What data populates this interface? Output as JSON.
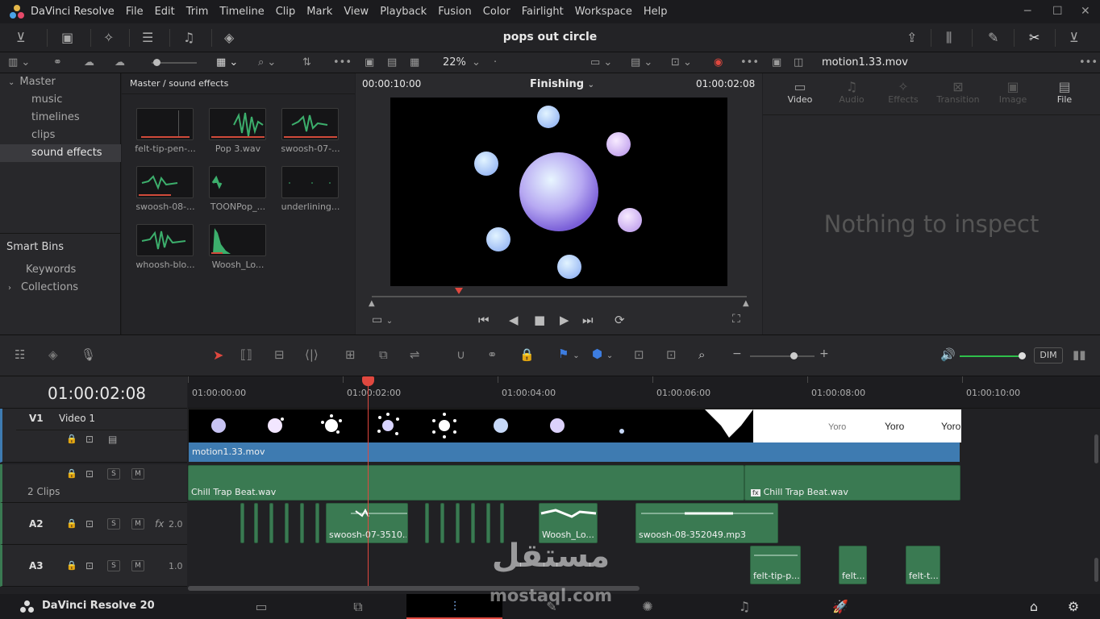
{
  "menu": {
    "app_name": "DaVinci Resolve",
    "items": [
      "File",
      "Edit",
      "Trim",
      "Timeline",
      "Clip",
      "Mark",
      "View",
      "Playback",
      "Fusion",
      "Color",
      "Fairlight",
      "Workspace",
      "Help"
    ]
  },
  "project_title": "pops out circle",
  "media_pool": {
    "zoom_label": "22%",
    "breadcrumb": "Master / sound effects",
    "bins": {
      "master": "Master",
      "children": [
        "music",
        "timelines",
        "clips",
        "sound effects"
      ],
      "selected": "sound effects"
    },
    "smart_bins": {
      "title": "Smart Bins",
      "items": [
        "Keywords",
        "Collections"
      ]
    },
    "clips": [
      "felt-tip-pen-...",
      "Pop 3.wav",
      "swoosh-07-...",
      "swoosh-08-...",
      "TOONPop_...",
      "underlining...",
      "whoosh-blo...",
      "Woosh_Lo..."
    ]
  },
  "viewer": {
    "timecode_left": "00:00:10:00",
    "mode": "Finishing",
    "timecode_right": "01:00:02:08"
  },
  "inspector": {
    "clip_name": "motion1.33.mov",
    "tabs": [
      "Video",
      "Audio",
      "Effects",
      "Transition",
      "Image",
      "File"
    ],
    "empty_message": "Nothing to inspect"
  },
  "timeline": {
    "timecode": "01:00:02:08",
    "dim_label": "DIM",
    "ruler": [
      "01:00:00:00",
      "01:00:02:00",
      "01:00:04:00",
      "01:00:06:00",
      "01:00:08:00",
      "01:00:10:00"
    ],
    "tracks": {
      "v1": {
        "id": "V1",
        "name": "Video 1",
        "clip": "motion1.33.mov",
        "title_text": "Yoro"
      },
      "a1": {
        "info": "2 Clips",
        "clip1": "Chill Trap Beat.wav",
        "clip2": "Chill Trap Beat.wav"
      },
      "a2": {
        "id": "A2",
        "level": "2.0",
        "fx": "fx",
        "clips": [
          "swoosh-07-3510...",
          "Woosh_Lo...",
          "swoosh-08-352049.mp3"
        ]
      },
      "a3": {
        "id": "A3",
        "level": "1.0",
        "clips": [
          "felt-tip-p...",
          "felt...",
          "felt-t..."
        ]
      }
    },
    "solo": "S",
    "mute": "M"
  },
  "footer": {
    "brand": "DaVinci Resolve 20"
  },
  "watermark": {
    "arabic": "مستقل",
    "latin": "mostaql.com"
  },
  "colors": {
    "accent_red": "#e0483f",
    "clip_video": "#3e7bb1",
    "clip_audio": "#3a7a52",
    "playhead": "#e0483f"
  }
}
